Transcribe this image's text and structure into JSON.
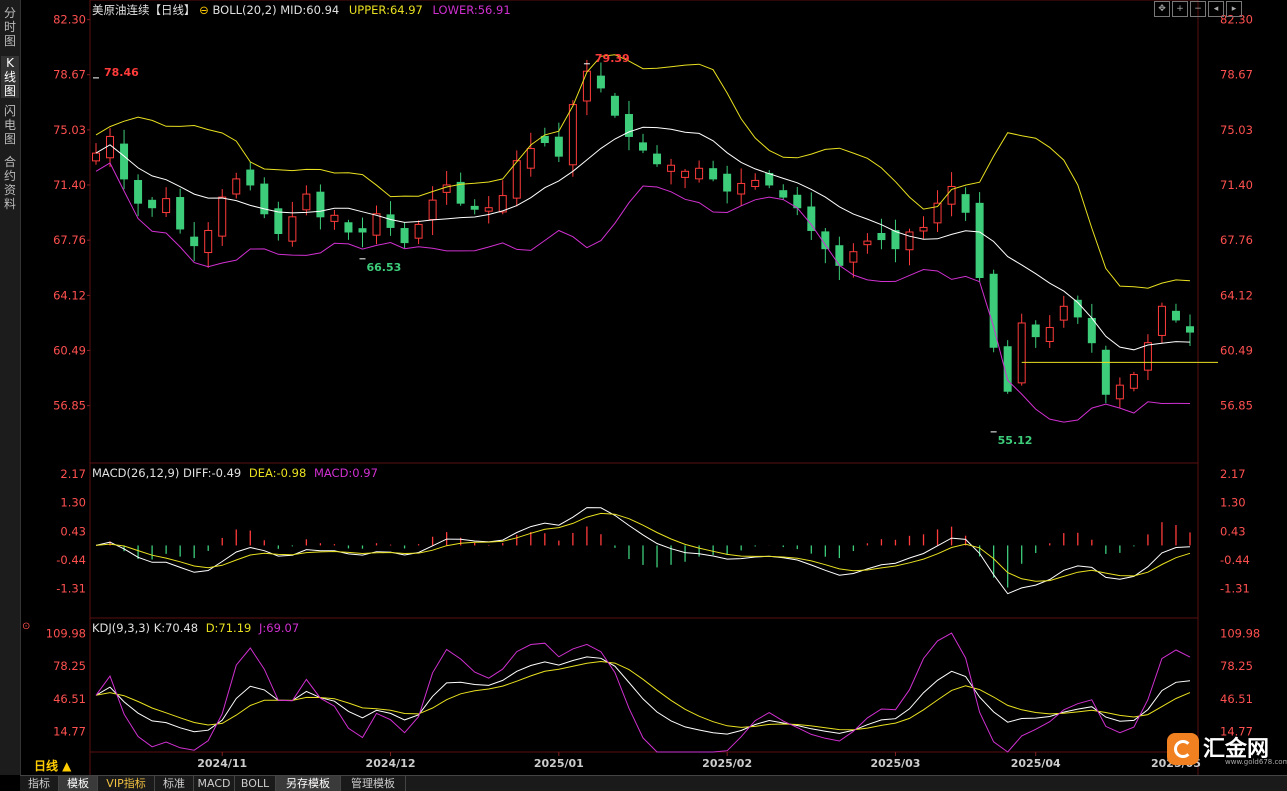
{
  "sidebar": {
    "items": [
      {
        "label": "分时图",
        "active": false
      },
      {
        "label": "K线图",
        "active": true
      },
      {
        "label": "闪电图",
        "active": false
      },
      {
        "label": "合约资料",
        "active": false
      }
    ]
  },
  "main_panel": {
    "title": "美原油连续【日线】",
    "indicator": "BOLL(20,2)",
    "mid_label": "MID:60.94",
    "upper_label": "UPPER:64.97",
    "lower_label": "LOWER:56.91",
    "y_ticks": [
      "82.30",
      "78.67",
      "75.03",
      "71.40",
      "67.76",
      "64.12",
      "60.49",
      "56.85"
    ],
    "annotations": {
      "high1": "78.46",
      "low1": "66.53",
      "high2": "79.39",
      "low2": "55.12"
    },
    "colors": {
      "up": "#ff3b3b",
      "down": "#3dcc7a",
      "mid": "#ffffff",
      "upper": "#e8e020",
      "lower": "#d030d0",
      "tick": "#ff5050"
    }
  },
  "macd_panel": {
    "label": "MACD(26,12,9)",
    "diff_label": "DIFF:-0.49",
    "dea_label": "DEA:-0.98",
    "macd_label": "MACD:0.97",
    "y_ticks": [
      "2.17",
      "1.30",
      "0.43",
      "-0.44",
      "-1.31"
    ]
  },
  "kdj_panel": {
    "label": "KDJ(9,3,3)",
    "k_label": "K:70.48",
    "d_label": "D:71.19",
    "j_label": "J:69.07",
    "y_ticks": [
      "109.98",
      "78.25",
      "46.51",
      "14.77"
    ]
  },
  "x_axis": {
    "period_label": "日线 ▲",
    "labels": [
      "2024/11",
      "2024/12",
      "2025/01",
      "2025/02",
      "2025/03",
      "2025/04",
      "2025/05"
    ]
  },
  "bottom_tabs": [
    {
      "label": "指标",
      "active": false,
      "vip": false
    },
    {
      "label": "模板",
      "active": true,
      "vip": false
    },
    {
      "label": "VIP指标",
      "active": false,
      "vip": true
    },
    {
      "label": "标准",
      "active": false,
      "vip": false
    },
    {
      "label": "MACD",
      "active": false,
      "vip": false
    },
    {
      "label": "BOLL",
      "active": false,
      "vip": false
    },
    {
      "label": "另存模板",
      "active": true,
      "vip": false
    },
    {
      "label": "管理模板",
      "active": false,
      "vip": false
    }
  ],
  "toolbar_icons": [
    "move-icon",
    "zoom-in-icon",
    "zoom-out-icon",
    "left-icon",
    "right-icon"
  ],
  "logo": {
    "name": "汇金网",
    "url": "www.gold678.com"
  },
  "chart_data": [
    {
      "type": "candlestick",
      "title": "美原油连续【日线】",
      "ylim": [
        53.2,
        83.2
      ],
      "x_labels": [
        "2024/11",
        "2024/12",
        "2025/01",
        "2025/02",
        "2025/03",
        "2025/04",
        "2025/05"
      ],
      "approx_close": [
        73.5,
        74.6,
        71.8,
        70.2,
        69.9,
        70.5,
        68.5,
        67.4,
        68.4,
        70.6,
        71.8,
        71.4,
        69.5,
        68.2,
        69.3,
        70.8,
        69.3,
        69.4,
        68.3,
        68.3,
        69.5,
        68.6,
        67.6,
        68.8,
        70.4,
        71.4,
        70.2,
        69.8,
        69.9,
        70.7,
        73.0,
        73.8,
        74.2,
        73.3,
        76.7,
        78.9,
        77.8,
        76.0,
        74.6,
        73.7,
        72.8,
        72.7,
        72.3,
        72.5,
        71.8,
        71.0,
        71.5,
        71.7,
        71.4,
        70.6,
        69.9,
        68.4,
        67.2,
        66.1,
        67.0,
        67.7,
        67.8,
        67.2,
        68.3,
        68.6,
        70.2,
        71.3,
        69.6,
        65.3,
        60.7,
        57.8,
        62.3,
        61.4,
        62.0,
        63.4,
        62.7,
        61.0,
        57.6,
        58.2,
        58.9,
        61.0,
        63.4,
        62.5,
        61.7
      ],
      "bollinger": {
        "mid": 60.94,
        "upper": 64.97,
        "lower": 56.91
      },
      "annotations": [
        {
          "value": 78.46,
          "label": "78.46"
        },
        {
          "value": 66.53,
          "label": "66.53"
        },
        {
          "value": 79.39,
          "label": "79.39"
        },
        {
          "value": 55.12,
          "label": "55.12"
        }
      ]
    },
    {
      "type": "macd",
      "ylim": [
        -2.2,
        2.5
      ],
      "latest": {
        "DIFF": -0.49,
        "DEA": -0.98,
        "MACD": 0.97
      }
    },
    {
      "type": "kdj",
      "ylim": [
        -5,
        125
      ],
      "latest": {
        "K": 70.48,
        "D": 71.19,
        "J": 69.07
      }
    }
  ]
}
